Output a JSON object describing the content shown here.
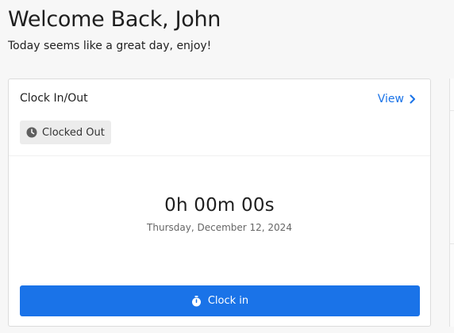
{
  "header": {
    "title": "Welcome Back, John",
    "subtitle": "Today seems like a great day, enjoy!"
  },
  "clock_card": {
    "title": "Clock In/Out",
    "view_label": "View",
    "status": "Clocked Out",
    "timer": "0h 00m 00s",
    "date": "Thursday, December 12, 2024",
    "button_label": "Clock in",
    "icons": {
      "view": "chevron-right-icon",
      "status": "clock-icon",
      "button": "stopwatch-icon"
    }
  },
  "colors": {
    "accent": "#1a73e8",
    "background": "#f7f7f7",
    "badge": "#ececec"
  }
}
